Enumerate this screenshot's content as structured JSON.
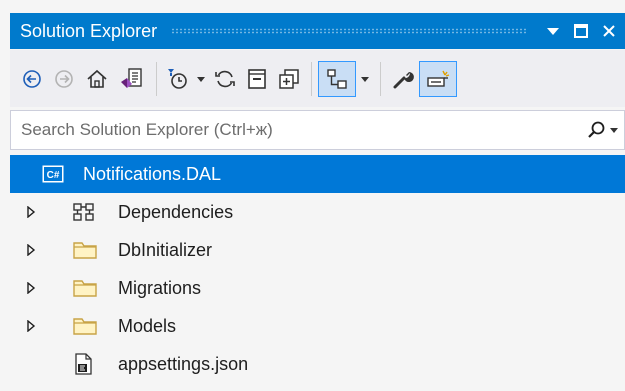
{
  "window": {
    "title": "Solution Explorer",
    "accent": "#007acc",
    "selection": "#0078d7"
  },
  "toolbar": {
    "icons": [
      "back-icon",
      "forward-icon",
      "home-icon",
      "switch-views-icon",
      "pending-changes-filter-icon",
      "sync-icon",
      "collapse-all-icon",
      "show-all-files-icon",
      "view-hierarchy-icon",
      "properties-icon",
      "preview-selected-items-icon"
    ]
  },
  "search": {
    "placeholder": "Search Solution Explorer (Ctrl+ж)"
  },
  "tree": {
    "items": [
      {
        "label": "Notifications.DAL",
        "icon": "csharp-project-icon",
        "selected": true
      },
      {
        "label": "Dependencies",
        "icon": "dependencies-icon",
        "expandable": true
      },
      {
        "label": "DbInitializer",
        "icon": "folder-icon",
        "expandable": true
      },
      {
        "label": "Migrations",
        "icon": "folder-icon",
        "expandable": true
      },
      {
        "label": "Models",
        "icon": "folder-icon",
        "expandable": true
      },
      {
        "label": "appsettings.json",
        "icon": "json-file-icon",
        "expandable": false
      }
    ]
  }
}
